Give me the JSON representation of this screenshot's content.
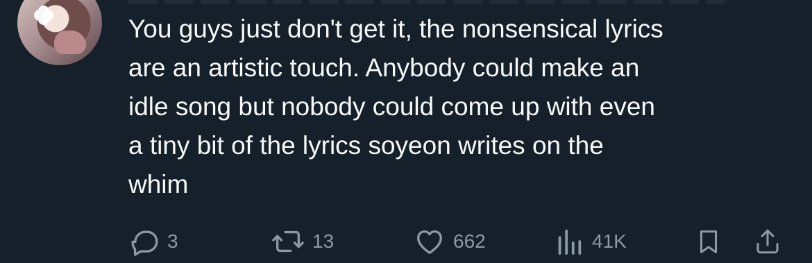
{
  "tweet": {
    "text": "You guys just don't get it, the nonsensical lyrics\nare an artistic touch. Anybody could make an\nidle song but nobody could come up with even\na tiny bit of the lyrics soyeon writes on the\nwhim"
  },
  "actions": {
    "reply_count": "3",
    "retweet_count": "13",
    "like_count": "662",
    "view_count": "41K"
  },
  "colors": {
    "background": "#15202b",
    "text": "#f7f9f9",
    "muted": "#8b98a5"
  },
  "icons": {
    "reply": "reply-icon",
    "retweet": "retweet-icon",
    "like": "heart-icon",
    "views": "analytics-icon",
    "bookmark": "bookmark-icon",
    "share": "share-icon"
  }
}
